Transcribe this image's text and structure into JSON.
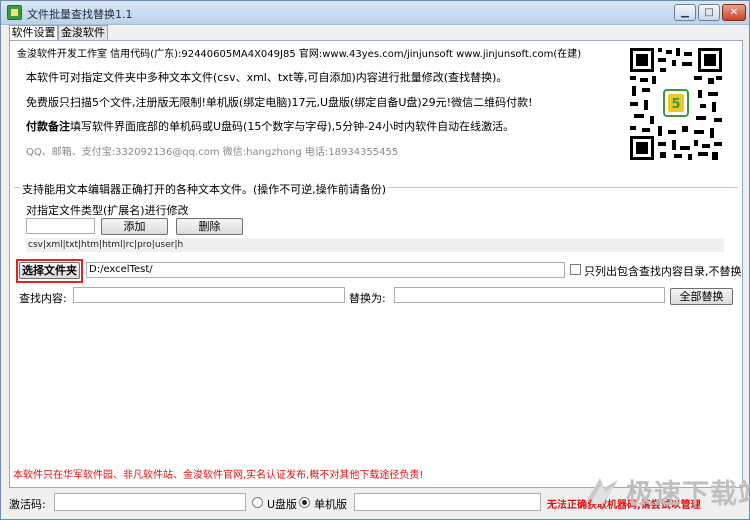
{
  "window": {
    "title": "文件批量查找替换1.1",
    "controls": {
      "minimize": "▁",
      "maximize": "□",
      "close": "✕"
    }
  },
  "tabs": [
    {
      "label": "软件设置",
      "active": true
    },
    {
      "label": "金浚软件",
      "active": false
    }
  ],
  "info": {
    "studio_line": "金浚软件开发工作室 信用代码(广东):92440605MA4X049J85 官网:www.43yes.com/jinjunsoft  www.jinjunsoft.com(在建)",
    "desc_line": "本软件可对指定文件夹中多种文本文件(csv、xml、txt等,可自添加)内容进行批量修改(查找替换)。",
    "price_line": "免费版只扫描5个文件,注册版无限制!单机版(绑定电脑)17元,U盘版(绑定自备U盘)29元!微信二维码付款!",
    "note_label": "付款备注",
    "note_text": "填写软件界面底部的单机码或U盘码(15个数字与字母),5分钟-24小时内软件自动在线激活。",
    "contact_line": "QQ、邮箱、支付宝:332092136@qq.com     微信:hangzhong     电话:18934355455"
  },
  "group": {
    "caption": "支持能用文本编辑器正确打开的各种文本文件。(操作不可逆,操作前请备份)",
    "ext_label": "对指定文件类型(扩展名)进行修改",
    "ext_input": "",
    "add_button": "添加",
    "delete_button": "删除",
    "ext_list": "csv|xml|txt|htm|html|rc|pro|user|h"
  },
  "folder": {
    "select_button": "选择文件夹",
    "path": "D:/excelTest/",
    "only_list_label": "只列出包含查找内容目录,不替换",
    "only_list_checked": false
  },
  "replace": {
    "find_label": "查找内容:",
    "find_value": "",
    "replace_label": "替换为:",
    "replace_value": "",
    "replace_all_button": "全部替换"
  },
  "footer": {
    "warning": "本软件只在华军软件园、非凡软件站、金浚软件官网,实名认证发布,概不对其他下载途径负责!",
    "activation_label": "激活码:",
    "activation_value": "",
    "usb_label": "U盘版",
    "standalone_label": "单机版",
    "selected_edition": "单机版",
    "status_text": "无法正确获取机器码,请尝试以管理"
  },
  "watermark": {
    "text": "极速下载站"
  },
  "colors": {
    "accent_red": "#e01010",
    "panel_border": "#9aa9bb",
    "window_bg": "#f0f0f0"
  }
}
